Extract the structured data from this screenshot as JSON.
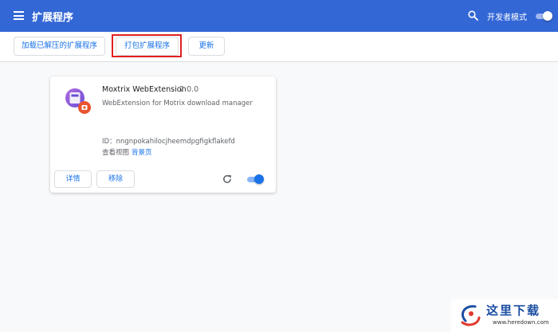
{
  "header": {
    "title": "扩展程序",
    "developer_mode_label": "开发者模式",
    "developer_mode_on": true,
    "icons": {
      "menu": "menu-icon",
      "search": "search-icon"
    }
  },
  "toolbar": {
    "load_unpacked_label": "加载已解压的扩展程序",
    "pack_label": "打包扩展程序",
    "update_label": "更新"
  },
  "extension": {
    "name": "Moxtrix WebExtension",
    "version": "2.0.0",
    "description": "WebExtension for Motrix download manager",
    "id_label": "ID：",
    "id": "nngnpokahilocjheemdpgfigkflakefd",
    "inspect_label": "查看视图",
    "inspect_link": "背景页",
    "details_label": "详情",
    "remove_label": "移除",
    "enabled": true,
    "icons": {
      "reload": "reload-icon"
    }
  },
  "watermark": {
    "title": "这里下载",
    "url": "www.heredown.com"
  },
  "colors": {
    "header_bg": "#3367d6",
    "accent": "#1a73e8",
    "highlight": "#e02020"
  }
}
